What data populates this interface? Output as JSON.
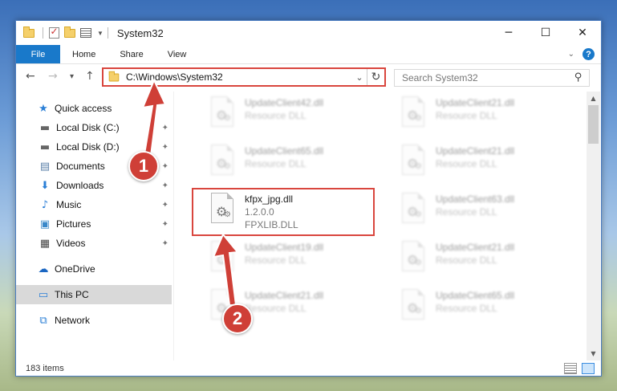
{
  "window": {
    "title": "System32",
    "controls": {
      "minimize": "─",
      "maximize": "☐",
      "close": "✕"
    }
  },
  "ribbon": {
    "tabs": [
      "File",
      "Home",
      "Share",
      "View"
    ],
    "help": "?"
  },
  "nav": {
    "back": "←",
    "forward": "→",
    "recent": "▾",
    "up": "↑"
  },
  "address": {
    "path": "C:\\Windows\\System32",
    "dropdown": "⌄",
    "refresh": "↻"
  },
  "search": {
    "placeholder": "Search System32",
    "icon": "⚲"
  },
  "sidebar": {
    "items": [
      {
        "label": "Quick access",
        "icon": "star-icon",
        "glyph": "★",
        "color": "#2b7fd6"
      },
      {
        "label": "Local Disk (C:)",
        "icon": "drive-icon",
        "glyph": "▬",
        "color": "#666666",
        "pinned": true
      },
      {
        "label": "Local Disk (D:)",
        "icon": "drive-icon",
        "glyph": "▬",
        "color": "#666666",
        "pinned": true
      },
      {
        "label": "Documents",
        "icon": "documents-icon",
        "glyph": "▤",
        "color": "#5a7fa8",
        "pinned": true
      },
      {
        "label": "Downloads",
        "icon": "download-icon",
        "glyph": "⬇",
        "color": "#2b7fd6",
        "pinned": true
      },
      {
        "label": "Music",
        "icon": "music-icon",
        "glyph": "♪",
        "color": "#2b7fd6",
        "pinned": true
      },
      {
        "label": "Pictures",
        "icon": "pictures-icon",
        "glyph": "▣",
        "color": "#3a88c9",
        "pinned": true
      },
      {
        "label": "Videos",
        "icon": "videos-icon",
        "glyph": "▦",
        "color": "#444444",
        "pinned": true
      },
      {
        "label": "OneDrive",
        "icon": "cloud-icon",
        "glyph": "☁",
        "color": "#1a66c2"
      },
      {
        "label": "This PC",
        "icon": "computer-icon",
        "glyph": "▭",
        "color": "#2b7fd6",
        "selected": true
      },
      {
        "label": "Network",
        "icon": "network-icon",
        "glyph": "⧉",
        "color": "#2b7fd6"
      }
    ],
    "pin_glyph": "✦"
  },
  "files": {
    "left_column": [
      {
        "name": "UpdateClient42.dll",
        "sub": "Resource DLL",
        "blurred": true
      },
      {
        "name": "UpdateClient65.dll",
        "sub": "Resource DLL",
        "blurred": true
      },
      {
        "name": "kfpx_jpg.dll",
        "version": "1.2.0.0",
        "sub": "FPXLIB.DLL",
        "blurred": false
      },
      {
        "name": "UpdateClient19.dll",
        "sub": "Resource DLL",
        "blurred": true
      },
      {
        "name": "UpdateClient21.dll",
        "sub": "Resource DLL",
        "blurred": true
      }
    ],
    "right_column": [
      {
        "name": "UpdateClient21.dll",
        "sub": "Resource DLL",
        "blurred": true
      },
      {
        "name": "UpdateClient21.dll",
        "sub": "Resource DLL",
        "blurred": true
      },
      {
        "name": "UpdateClient63.dll",
        "sub": "Resource DLL",
        "blurred": true
      },
      {
        "name": "UpdateClient21.dll",
        "sub": "Resource DLL",
        "blurred": true
      },
      {
        "name": "UpdateClient65.dll",
        "sub": "Resource DLL",
        "blurred": true
      }
    ]
  },
  "status": {
    "item_count": "183 items"
  },
  "annotations": {
    "step1": "1",
    "step2": "2",
    "color": "#cf3f37"
  }
}
